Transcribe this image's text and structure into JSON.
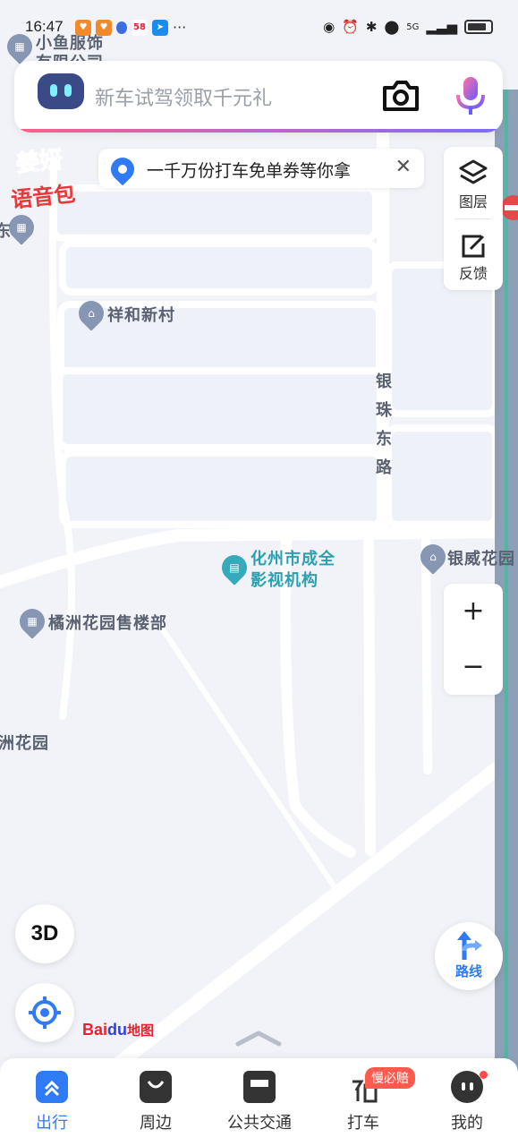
{
  "status_bar": {
    "time": "16:47",
    "network": "5G",
    "more": "···"
  },
  "search": {
    "placeholder": "新车试驾领取千元礼"
  },
  "voice_pack": {
    "line1": "姜妍",
    "line2": "语音包"
  },
  "promo": {
    "text": "一千万份打车免单券等你拿",
    "close": "✕"
  },
  "side_panel": {
    "layers": "图层",
    "feedback": "反馈"
  },
  "zoom": {
    "in": "+",
    "out": "−"
  },
  "map_labels": {
    "top_left_top": "小鱼服饰",
    "top_left_bottom": "有限公司",
    "left_edge": "东",
    "xianghe": "祥和新村",
    "yinzhu_road": [
      "银",
      "珠",
      "东",
      "路"
    ],
    "cinema_line1": "化州市成全",
    "cinema_line2": "影视机构",
    "yinwei": "银威花园",
    "juzhou_sales": "橘洲花园售楼部",
    "juzhou_garden": "洲花园"
  },
  "buttons": {
    "three_d": "3D",
    "route": "路线"
  },
  "logo": {
    "bai": "Bai",
    "du": "du",
    "cn": "地图"
  },
  "bottom_nav": [
    {
      "label": "出行",
      "active": true
    },
    {
      "label": "周边"
    },
    {
      "label": "公共交通"
    },
    {
      "label": "打车"
    },
    {
      "label": "我的"
    }
  ],
  "badge": "慢必赔",
  "colors": {
    "accent": "#2f7af5",
    "badge": "#ff5a4e",
    "poi_teal": "#36a9bb",
    "map_bg": "#f1f3f8",
    "road": "#ffffff"
  }
}
